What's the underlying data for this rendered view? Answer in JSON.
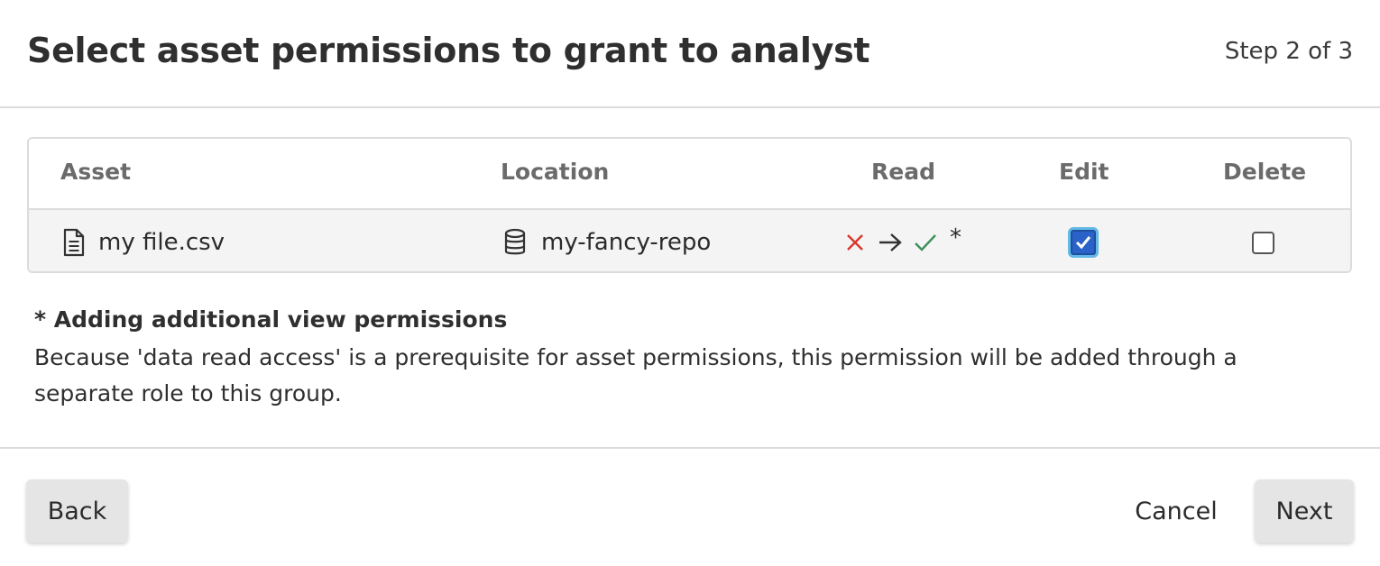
{
  "header": {
    "title": "Select asset permissions to grant to analyst",
    "step": "Step 2 of 3"
  },
  "table": {
    "columns": [
      "Asset",
      "Location",
      "Read",
      "Edit",
      "Delete"
    ],
    "rows": [
      {
        "asset": "my file.csv",
        "asset_icon": "file-icon",
        "location": "my-fancy-repo",
        "location_icon": "database-icon",
        "read": {
          "from_icon": "x-icon",
          "arrow_icon": "arrow-right-icon",
          "to_icon": "check-icon",
          "note_marker": "*"
        },
        "edit_checked": true,
        "delete_checked": false
      }
    ]
  },
  "note": {
    "title": "* Adding additional view permissions",
    "body": "Because 'data read access' is a prerequisite for asset permissions, this permission will be added through a separate role to this group."
  },
  "footer": {
    "back_label": "Back",
    "cancel_label": "Cancel",
    "next_label": "Next"
  },
  "colors": {
    "x_red": "#d9342b",
    "check_green": "#3f8f5a",
    "checkbox_blue": "#2a62c9",
    "focus_ring": "#62b8e6"
  }
}
